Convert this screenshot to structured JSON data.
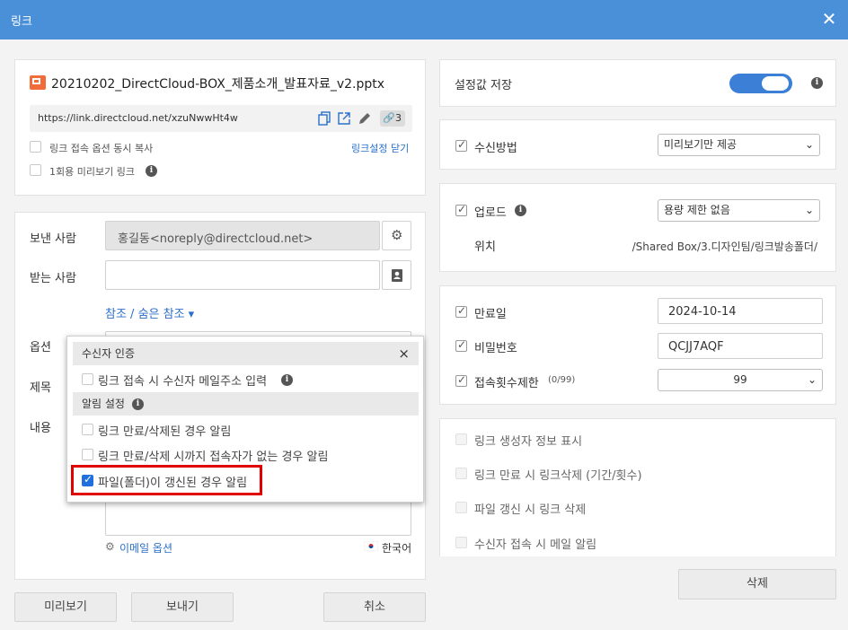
{
  "window": {
    "title": "링크"
  },
  "file": {
    "name": "20210202_DirectCloud-BOX_제품소개_발표자료_v2.pptx",
    "url": "https://link.directcloud.net/xzuNwwHt4w",
    "link_count": "3",
    "copy_option_label": "링크 접속 옵션 동시 복사",
    "close_settings_link": "링크설정 닫기",
    "one_time_preview_label": "1회용 미리보기 링크"
  },
  "mail": {
    "sender_label": "보낸 사람",
    "sender_value": "홍길동<noreply@directcloud.net>",
    "recipient_label": "받는 사람",
    "cc_bcc_link": "참조 / 숨은 참조 ▾",
    "options_label": "옵션",
    "subject_label": "제목",
    "body_label": "내용",
    "email_options_link": "이메일 옵션",
    "language": "한국어"
  },
  "popup": {
    "section1_title": "수신자 인증",
    "option_enter_email": "링크 접속 시 수신자 메일주소 입력",
    "section2_title": "알림 설정",
    "option_notify_expired": "링크 만료/삭제된 경우 알림",
    "option_notify_no_access": "링크 만료/삭제 시까지 접속자가 없는 경우 알림",
    "option_notify_file_updated": "파일(폴더)이 갱신된 경우 알림",
    "close": "×"
  },
  "settings": {
    "save_label": "설정값 저장",
    "save_enabled": true,
    "receive_method_label": "수신방법",
    "receive_method_value": "미리보기만 제공",
    "upload_label": "업로드",
    "upload_value": "용량 제한 없음",
    "location_label": "위치",
    "location_value": "/Shared Box/3.디자인팀/링크발송폴더/",
    "expiry_label": "만료일",
    "expiry_value": "2024-10-14",
    "password_label": "비밀번호",
    "password_value": "QCJJ7AQF",
    "access_limit_label": "접속횟수제한",
    "access_limit_range": "(0/99)",
    "access_limit_value": "99",
    "show_creator_label": "링크 생성자 정보 표시",
    "auto_delete_label": "링크 만료 시 링크삭제 (기간/횟수)",
    "delete_on_update_label": "파일 갱신 시 링크 삭제",
    "notify_on_access_label": "수신자 접속 시 메일 알림"
  },
  "buttons": {
    "preview": "미리보기",
    "send": "보내기",
    "cancel": "취소",
    "delete": "삭제"
  },
  "colors": {
    "titlebar": "#4a90d9",
    "toggle": "#3b7fd6",
    "highlight": "#e00000"
  }
}
